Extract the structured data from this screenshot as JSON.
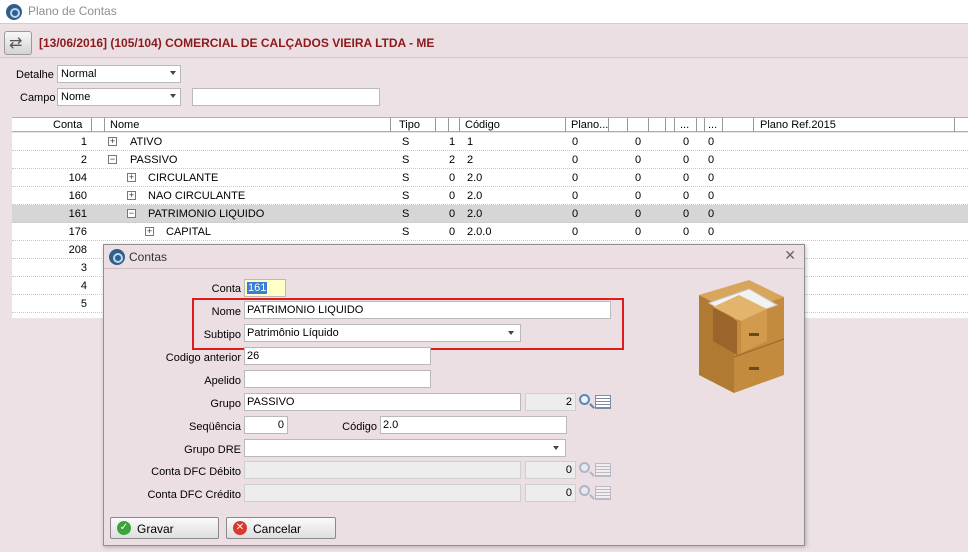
{
  "window": {
    "title": "Plano de Contas"
  },
  "header": {
    "company": "[13/06/2016] (105/104) COMERCIAL DE CALÇADOS VIEIRA LTDA - ME"
  },
  "filters": {
    "detalhe_label": "Detalhe",
    "detalhe_value": "Normal",
    "campo_label": "Campo",
    "campo_value": "Nome",
    "search_value": ""
  },
  "grid": {
    "columns": [
      "Conta",
      "Nome",
      "Tipo",
      "Código",
      "Plano...",
      "...",
      "...",
      "Plano Ref.2015"
    ],
    "rows": [
      {
        "conta": "1",
        "nome": "ATIVO",
        "tipo": "S",
        "n1": "1",
        "codigo": "1",
        "p1": "0",
        "p2": "0",
        "p3": "0",
        "p4": "0"
      },
      {
        "conta": "2",
        "nome": "PASSIVO",
        "tipo": "S",
        "n1": "2",
        "codigo": "2",
        "p1": "0",
        "p2": "0",
        "p3": "0",
        "p4": "0"
      },
      {
        "conta": "104",
        "nome": "CIRCULANTE",
        "tipo": "S",
        "n1": "0",
        "codigo": "2.0",
        "p1": "0",
        "p2": "0",
        "p3": "0",
        "p4": "0"
      },
      {
        "conta": "160",
        "nome": "NAO CIRCULANTE",
        "tipo": "S",
        "n1": "0",
        "codigo": "2.0",
        "p1": "0",
        "p2": "0",
        "p3": "0",
        "p4": "0"
      },
      {
        "conta": "161",
        "nome": "PATRIMONIO LIQUIDO",
        "tipo": "S",
        "n1": "0",
        "codigo": "2.0",
        "p1": "0",
        "p2": "0",
        "p3": "0",
        "p4": "0"
      },
      {
        "conta": "176",
        "nome": "CAPITAL",
        "tipo": "S",
        "n1": "0",
        "codigo": "2.0.0",
        "p1": "0",
        "p2": "0",
        "p3": "0",
        "p4": "0"
      },
      {
        "conta": "208"
      },
      {
        "conta": "3"
      },
      {
        "conta": "4"
      },
      {
        "conta": "5"
      }
    ]
  },
  "dialog": {
    "title": "Contas",
    "conta_label": "Conta",
    "conta_value": "161",
    "nome_label": "Nome",
    "nome_value": "PATRIMONIO LIQUIDO",
    "subtipo_label": "Subtipo",
    "subtipo_value": "Patrimônio Líquido",
    "codigo_anterior_label": "Codigo anterior",
    "codigo_anterior_value": "26",
    "apelido_label": "Apelido",
    "apelido_value": "",
    "grupo_label": "Grupo",
    "grupo_value": "PASSIVO",
    "grupo_num": "2",
    "sequencia_label": "Seqüência",
    "sequencia_value": "0",
    "codigo_label": "Código",
    "codigo_value": "2.0",
    "grupo_dre_label": "Grupo DRE",
    "grupo_dre_value": "",
    "dfc_debito_label": "Conta DFC Débito",
    "dfc_debito_num": "0",
    "dfc_credito_label": "Conta DFC Crédito",
    "dfc_credito_num": "0",
    "gravar_label": "Gravar",
    "cancelar_label": "Cancelar"
  },
  "colors": {
    "accent_red": "#e01b1b",
    "company_text": "#8b1a1a",
    "gravar_icon": "#3aa63a",
    "cancelar_icon": "#d93a2b"
  }
}
